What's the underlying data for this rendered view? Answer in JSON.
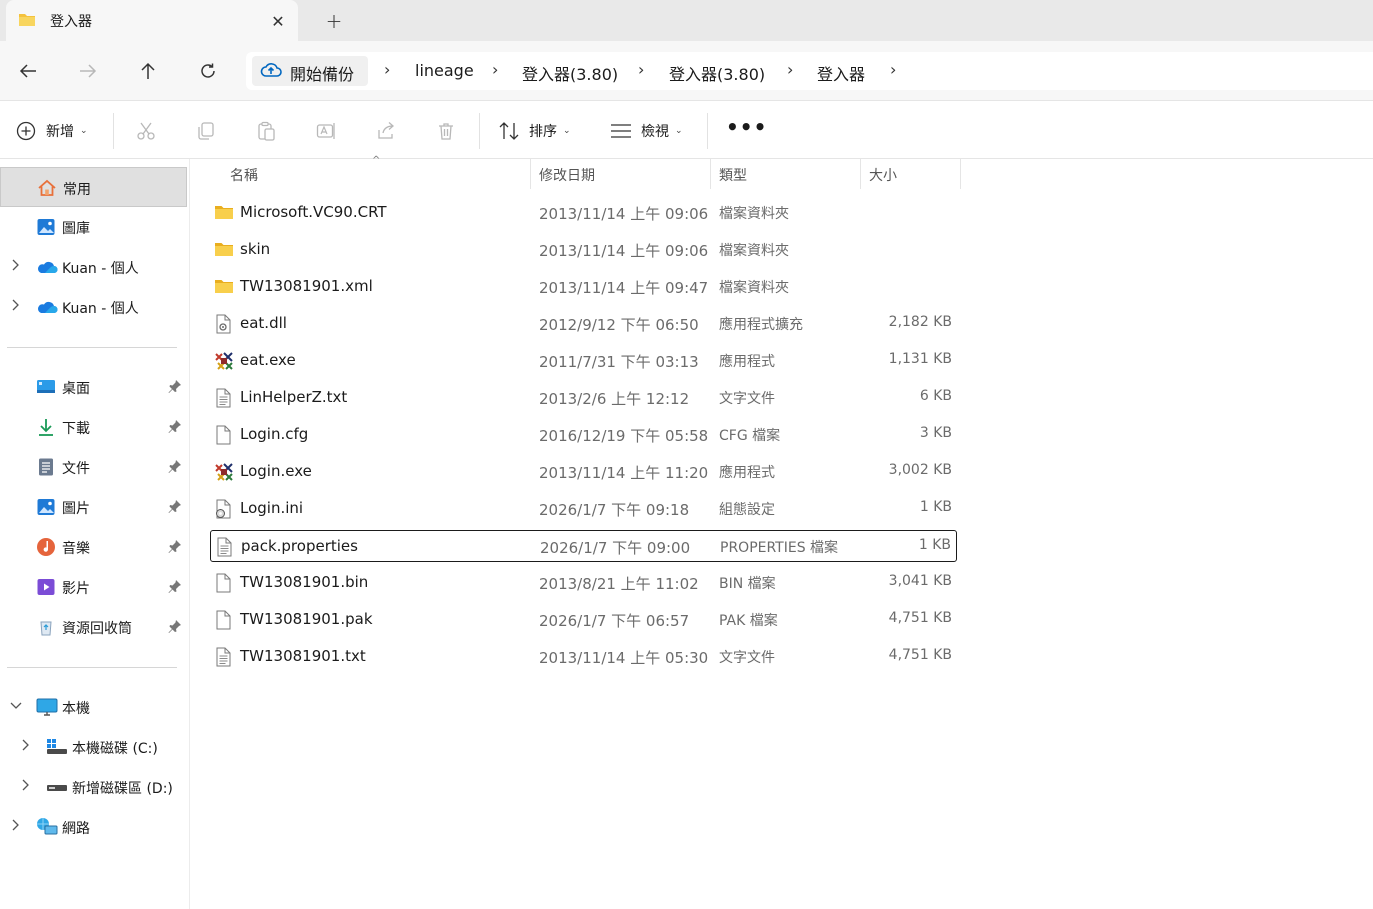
{
  "window": {
    "tab_title": "登入器",
    "tab_close": "✕",
    "new_tab": "+"
  },
  "nav": {
    "back": "←",
    "forward": "→",
    "up": "↑",
    "refresh": "↻"
  },
  "breadcrumb": {
    "root": "開始備份",
    "items": [
      "lineage",
      "登入器(3.80)",
      "登入器(3.80)",
      "登入器"
    ],
    "separator": "›"
  },
  "toolbar": {
    "new_label": "新增",
    "sort_label": "排序",
    "view_label": "檢視",
    "more_label": "•••",
    "caret": "⌄"
  },
  "sidebar": {
    "quick": [
      {
        "label": "常用",
        "icon": "home-icon"
      },
      {
        "label": "圖庫",
        "icon": "gallery-icon"
      },
      {
        "label": "Kuan - 個人",
        "icon": "onedrive-icon"
      },
      {
        "label": "Kuan - 個人",
        "icon": "onedrive-icon"
      }
    ],
    "pinned": [
      {
        "label": "桌面",
        "icon": "desktop-icon"
      },
      {
        "label": "下載",
        "icon": "download-icon"
      },
      {
        "label": "文件",
        "icon": "documents-icon"
      },
      {
        "label": "圖片",
        "icon": "pictures-icon"
      },
      {
        "label": "音樂",
        "icon": "music-icon"
      },
      {
        "label": "影片",
        "icon": "videos-icon"
      },
      {
        "label": "資源回收筒",
        "icon": "recycle-bin-icon"
      }
    ],
    "devices": [
      {
        "label": "本機",
        "icon": "this-pc-icon"
      },
      {
        "label": "本機磁碟 (C:)",
        "icon": "drive-c-icon"
      },
      {
        "label": "新增磁碟區 (D:)",
        "icon": "drive-d-icon"
      },
      {
        "label": "網路",
        "icon": "network-icon"
      }
    ]
  },
  "columns": {
    "name": "名稱",
    "modified": "修改日期",
    "type": "類型",
    "size": "大小",
    "sort_indicator": "^"
  },
  "files": [
    {
      "name": "Microsoft.VC90.CRT",
      "modified": "2013/11/14 上午 09:06",
      "type": "檔案資料夾",
      "size": "",
      "icon": "folder-icon"
    },
    {
      "name": "skin",
      "modified": "2013/11/14 上午 09:06",
      "type": "檔案資料夾",
      "size": "",
      "icon": "folder-icon"
    },
    {
      "name": "TW13081901.xml",
      "modified": "2013/11/14 上午 09:47",
      "type": "檔案資料夾",
      "size": "",
      "icon": "folder-icon"
    },
    {
      "name": "eat.dll",
      "modified": "2012/9/12 下午 06:50",
      "type": "應用程式擴充",
      "size": "2,182 KB",
      "icon": "dll-file-icon"
    },
    {
      "name": "eat.exe",
      "modified": "2011/7/31 下午 03:13",
      "type": "應用程式",
      "size": "1,131 KB",
      "icon": "exe-app-icon"
    },
    {
      "name": "LinHelperZ.txt",
      "modified": "2013/2/6 上午 12:12",
      "type": "文字文件",
      "size": "6 KB",
      "icon": "text-file-icon"
    },
    {
      "name": "Login.cfg",
      "modified": "2016/12/19 下午 05:58",
      "type": "CFG 檔案",
      "size": "3 KB",
      "icon": "blank-file-icon"
    },
    {
      "name": "Login.exe",
      "modified": "2013/11/14 上午 11:20",
      "type": "應用程式",
      "size": "3,002 KB",
      "icon": "exe-app-icon"
    },
    {
      "name": "Login.ini",
      "modified": "2026/1/7 下午 09:18",
      "type": "組態設定",
      "size": "1 KB",
      "icon": "settings-file-icon"
    },
    {
      "name": "pack.properties",
      "modified": "2026/1/7 下午 09:00",
      "type": "PROPERTIES 檔案",
      "size": "1 KB",
      "icon": "text-file-icon"
    },
    {
      "name": "TW13081901.bin",
      "modified": "2013/8/21 上午 11:02",
      "type": "BIN 檔案",
      "size": "3,041 KB",
      "icon": "blank-file-icon"
    },
    {
      "name": "TW13081901.pak",
      "modified": "2026/1/7 下午 06:57",
      "type": "PAK 檔案",
      "size": "4,751 KB",
      "icon": "blank-file-icon"
    },
    {
      "name": "TW13081901.txt",
      "modified": "2013/11/14 上午 05:30",
      "type": "文字文件",
      "size": "4,751 KB",
      "icon": "text-file-icon"
    }
  ],
  "colors": {
    "folder": "#f4c23d",
    "accent": "#0067c0",
    "selected_bg": "#e0e0e0"
  }
}
